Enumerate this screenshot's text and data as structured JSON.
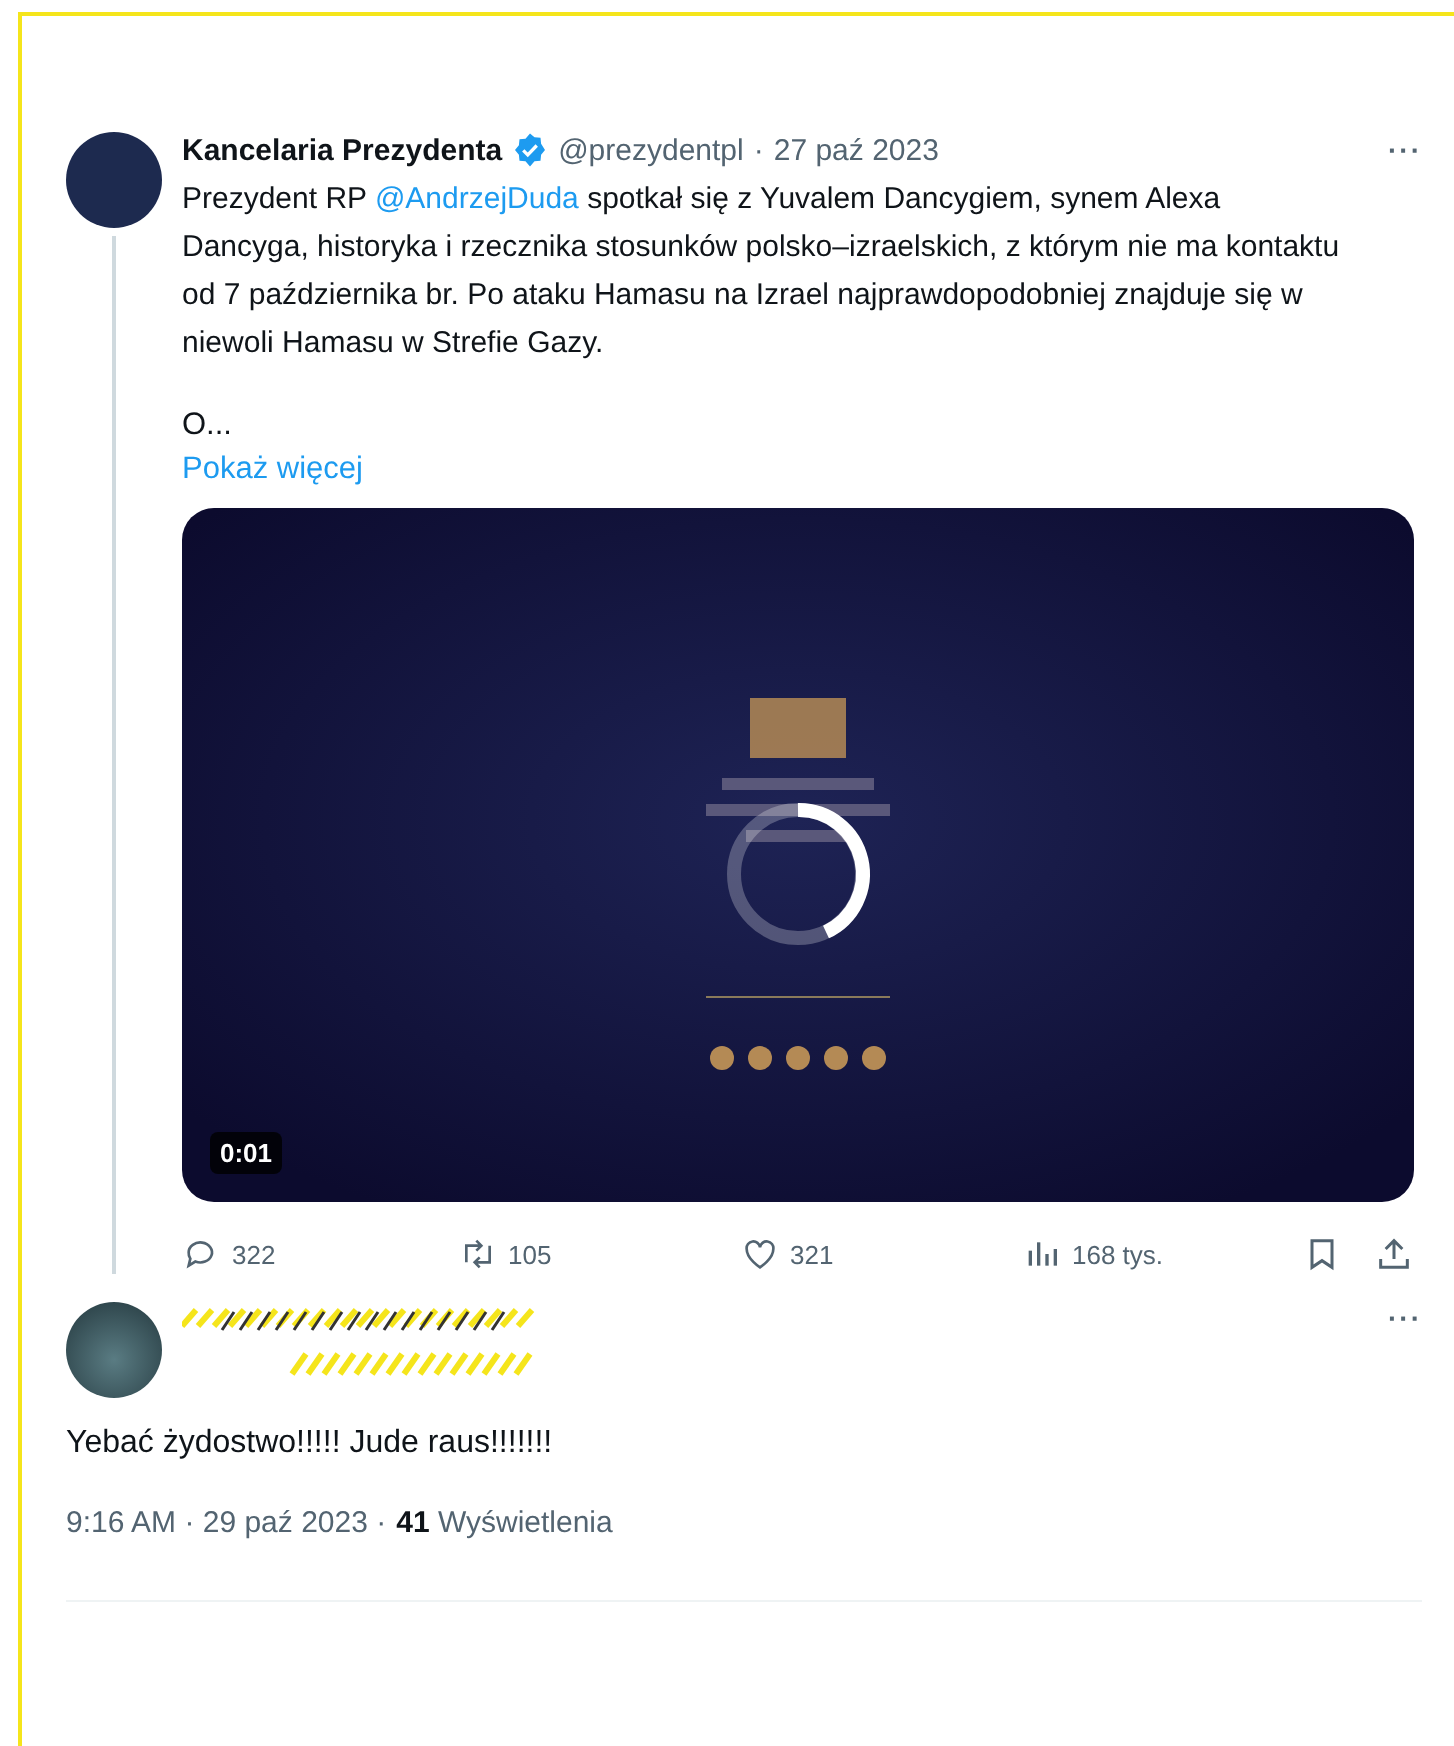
{
  "tweet": {
    "author_name": "Kancelaria Prezydenta",
    "verified": true,
    "handle": "@prezydentpl",
    "separator": "·",
    "date": "27 paź 2023",
    "more": "···",
    "text_before": "Prezydent RP",
    "mention": "@AndrzejDuda",
    "text_after": "spotkał się z Yuvalem Dancygiem, synem Alexa Dancyga, historyka i rzecznika stosunków polsko–izraelskich, z którym nie ma kontaktu od 7 października br. Po ataku Hamasu na Izrael najprawdopodobniej znajduje się w niewoli Hamasu w Strefie Gazy.",
    "truncated": "O...",
    "show_more": "Pokaż więcej",
    "video": {
      "kind": "picture",
      "duration": "0:01",
      "loading": true
    },
    "actions": [
      {
        "kind": "reply",
        "count": "322"
      },
      {
        "kind": "retweet",
        "count": "105"
      },
      {
        "kind": "like",
        "count": "321"
      },
      {
        "kind": "views",
        "count": "168 tys."
      },
      {
        "kind": "bookmark"
      },
      {
        "kind": "share"
      }
    ]
  },
  "reply": {
    "more": "···",
    "redacted": true,
    "text": "Yebać żydostwo!!!!! Jude raus!!!!!!!",
    "time": "9:16 AM · 29 paź 2023 ·",
    "views_count": "41",
    "views_label": "Wyświetlenia"
  }
}
